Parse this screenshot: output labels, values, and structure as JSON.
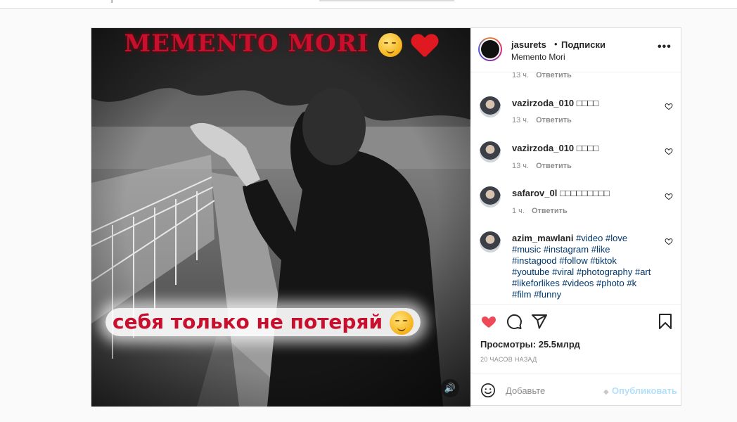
{
  "topbar": {
    "logo_fragment": "г"
  },
  "post": {
    "username": "jasurets",
    "follow_label": "Подписки",
    "location": "Memento Mori",
    "more_label": "•••",
    "overlay_top_text": "MEMENTO MORI",
    "overlay_bottom_text": "себя только не потеряй"
  },
  "comments": [
    {
      "user": "",
      "text": "",
      "time": "13 ч.",
      "reply": "Ответить"
    },
    {
      "user": "vazirzoda_010",
      "text": "□□□□",
      "time": "13 ч.",
      "reply": "Ответить"
    },
    {
      "user": "vazirzoda_010",
      "text": "□□□□",
      "time": "13 ч.",
      "reply": "Ответить"
    },
    {
      "user": "safarov_0l",
      "text": "□□□□□□□□□",
      "time": "1 ч.",
      "reply": "Ответить"
    },
    {
      "user": "azim_mawlani",
      "tags": [
        "#video",
        "#love",
        "#music",
        "#instagram",
        "#like",
        "#instagood",
        "#follow",
        "#tiktok",
        "#youtube",
        "#viral",
        "#photography",
        "#art",
        "#likeforlikes",
        "#videos",
        "#photo",
        "#k",
        "#film",
        "#funny"
      ]
    }
  ],
  "stats": {
    "views_label": "Просмотры:",
    "views_value": "25.5млрд",
    "timestamp": "20 часов назад"
  },
  "add_comment": {
    "placeholder": "Добавьте",
    "publish_label": "Опубликовать"
  },
  "colors": {
    "liked_heart": "#ed4956",
    "link": "#00376b",
    "publish_disabled": "#b2dffc",
    "overlay_red": "#c8102e"
  },
  "icons": [
    "heart-filled-icon",
    "comment-icon",
    "share-icon",
    "bookmark-icon",
    "smile-icon",
    "sound-icon",
    "more-icon"
  ]
}
